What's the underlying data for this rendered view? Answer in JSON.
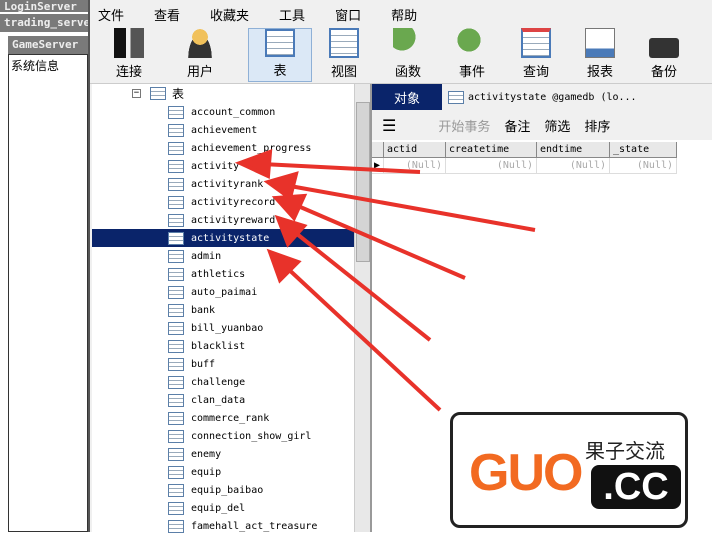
{
  "left": {
    "windows": [
      "LoginServer",
      "trading_server",
      "GameServer"
    ],
    "panel_text": "系统信息"
  },
  "menu": [
    "文件",
    "查看",
    "收藏夹",
    "工具",
    "窗口",
    "帮助"
  ],
  "toolbar": [
    "连接",
    "用户",
    "表",
    "视图",
    "函数",
    "事件",
    "查询",
    "报表",
    "备份"
  ],
  "tree": {
    "root": "表",
    "items": [
      "account_common",
      "achievement",
      "achievement_progress",
      "activity",
      "activityrank",
      "activityrecord",
      "activityreward",
      "activitystate",
      "admin",
      "athletics",
      "auto_paimai",
      "bank",
      "bill_yuanbao",
      "blacklist",
      "buff",
      "challenge",
      "clan_data",
      "commerce_rank",
      "connection_show_girl",
      "enemy",
      "equip",
      "equip_baibao",
      "equip_del",
      "famehall_act_treasure"
    ],
    "selected": "activitystate"
  },
  "tabs": {
    "objects": "对象",
    "table_tab": "activitystate @gamedb (lo..."
  },
  "subtoolbar": {
    "begin_transaction": "开始事务",
    "note": "备注",
    "filter": "筛选",
    "sort": "排序"
  },
  "grid": {
    "columns": [
      "actid",
      "createtime",
      "endtime",
      "_state"
    ],
    "rows": [
      [
        "(Null)",
        "(Null)",
        "(Null)",
        "(Null)"
      ]
    ]
  },
  "watermark": {
    "logo": "GUO.CC",
    "tagline": "果子交流"
  },
  "colors": {
    "selection": "#0a246a",
    "arrow": "#e8322a",
    "logo_orange": "#f26a21"
  }
}
